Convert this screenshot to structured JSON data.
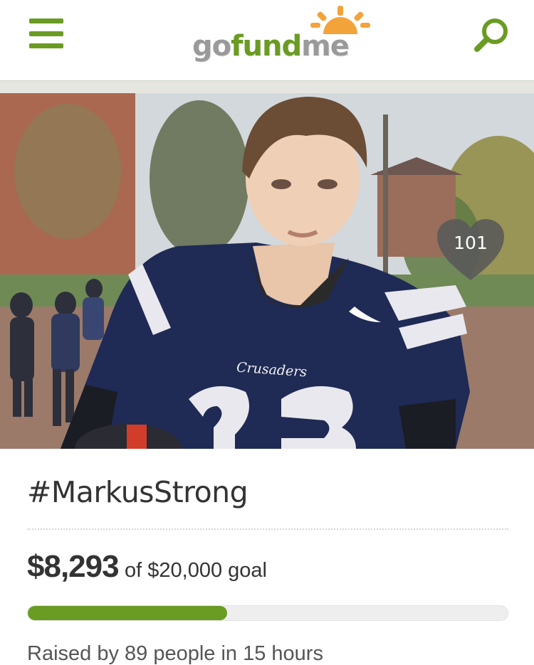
{
  "brand": {
    "logo_go": "go",
    "logo_fund": "fund",
    "logo_me": "me",
    "brand_green": "#6a9b22",
    "brand_gray": "#9a9a9a",
    "sun_color": "#f2a33a"
  },
  "header": {
    "menu_icon": "hamburger-menu-icon",
    "search_icon": "search-icon"
  },
  "hero": {
    "jersey_text": "Crusaders",
    "like_icon": "heart-icon",
    "like_count": "101"
  },
  "campaign": {
    "title": "#MarkusStrong",
    "raised": "$8,293",
    "goal_text": "of $20,000 goal",
    "progress_fraction": 0.4147,
    "raised_by": "Raised by 89 people in 15 hours"
  }
}
